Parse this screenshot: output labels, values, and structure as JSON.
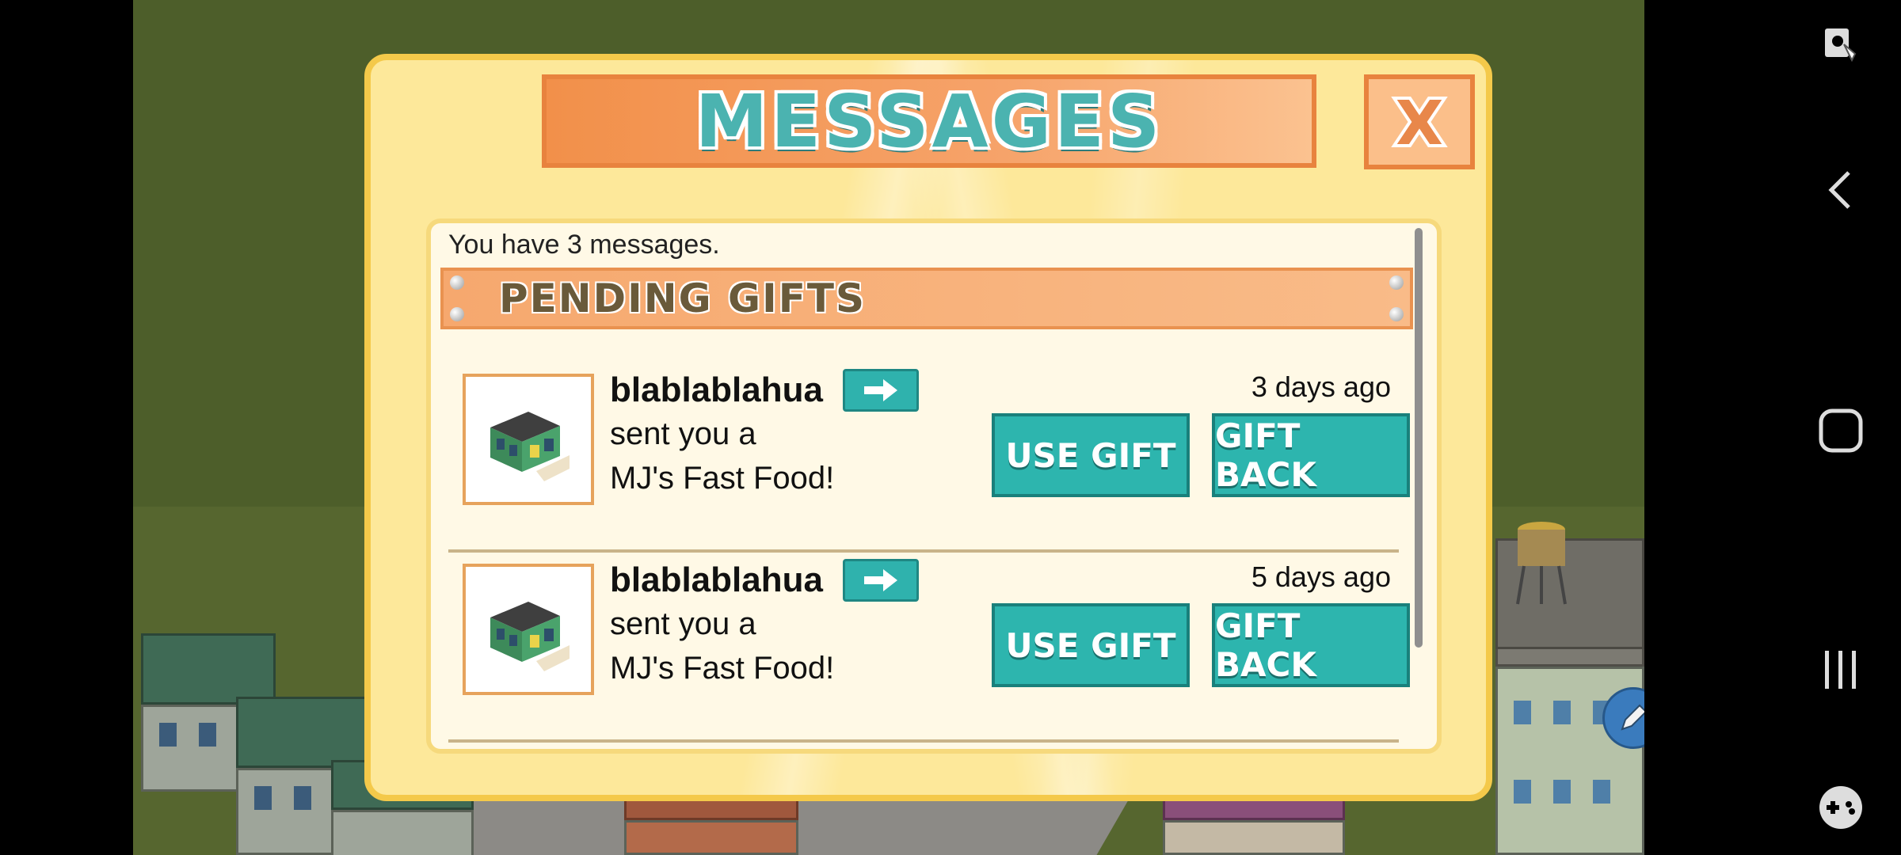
{
  "colors": {
    "modal_bg": "#fde89a",
    "banner": "#f2904a",
    "teal_button": "#2db5ae",
    "ground": "#4d5e2a"
  },
  "modal": {
    "title": "MESSAGES",
    "close_label": "X",
    "message_count": "You have 3 messages.",
    "section_title": "PENDING GIFTS",
    "gifts": [
      {
        "sender": "blablablahua",
        "line1": "sent you a",
        "line2": "MJ's Fast Food!",
        "time": "3 days ago",
        "use_label": "USE GIFT",
        "back_label": "GIFT BACK",
        "icon": "building-icon"
      },
      {
        "sender": "blablablahua",
        "line1": "sent you a",
        "line2": "MJ's Fast Food!",
        "time": "5 days ago",
        "use_label": "USE GIFT",
        "back_label": "GIFT BACK",
        "icon": "building-icon"
      }
    ]
  },
  "navbar": {
    "icons": [
      "screen-capture-icon",
      "back-icon",
      "home-icon",
      "recents-icon",
      "game-controller-icon"
    ]
  }
}
